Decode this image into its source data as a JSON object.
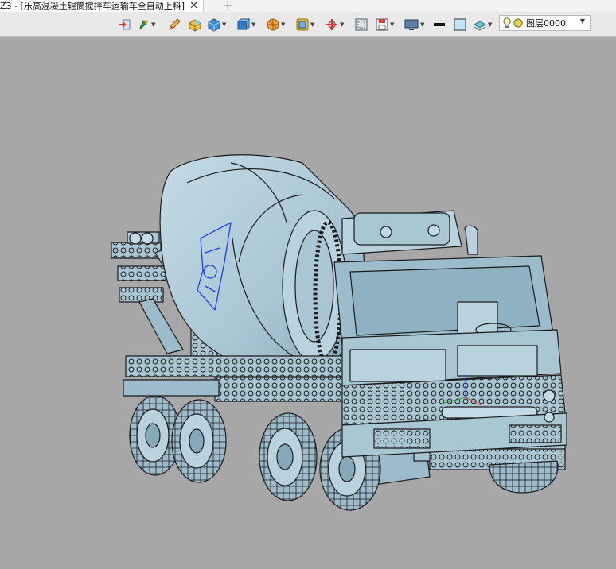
{
  "document_tab": {
    "title": "Z3 - [乐高混凝土辊筒搅拌车运输车全自动上料]",
    "close_glyph": "✕",
    "add_glyph": "+"
  },
  "toolbar": {
    "icons": [
      "export-icon",
      "paint-icon",
      "pencil-icon",
      "block-icon",
      "cube-icon",
      "view-cube-icon",
      "sphere-icon",
      "frame-icon",
      "axis-icon",
      "fit-icon",
      "save-view-icon",
      "display-icon",
      "line-color-swatch",
      "fill-color-swatch",
      "layer-stack-icon"
    ],
    "layer": {
      "value": "图层0000",
      "icons": [
        "lightbulb-icon",
        "layer-color-dot"
      ]
    }
  },
  "colors": {
    "viewport_bg": "#a7a7a7",
    "model_fill": "#a9c6d3",
    "model_shade": "#7fa3b3",
    "model_edge": "#1b1b1b",
    "logo_stroke": "#1f3cff"
  }
}
